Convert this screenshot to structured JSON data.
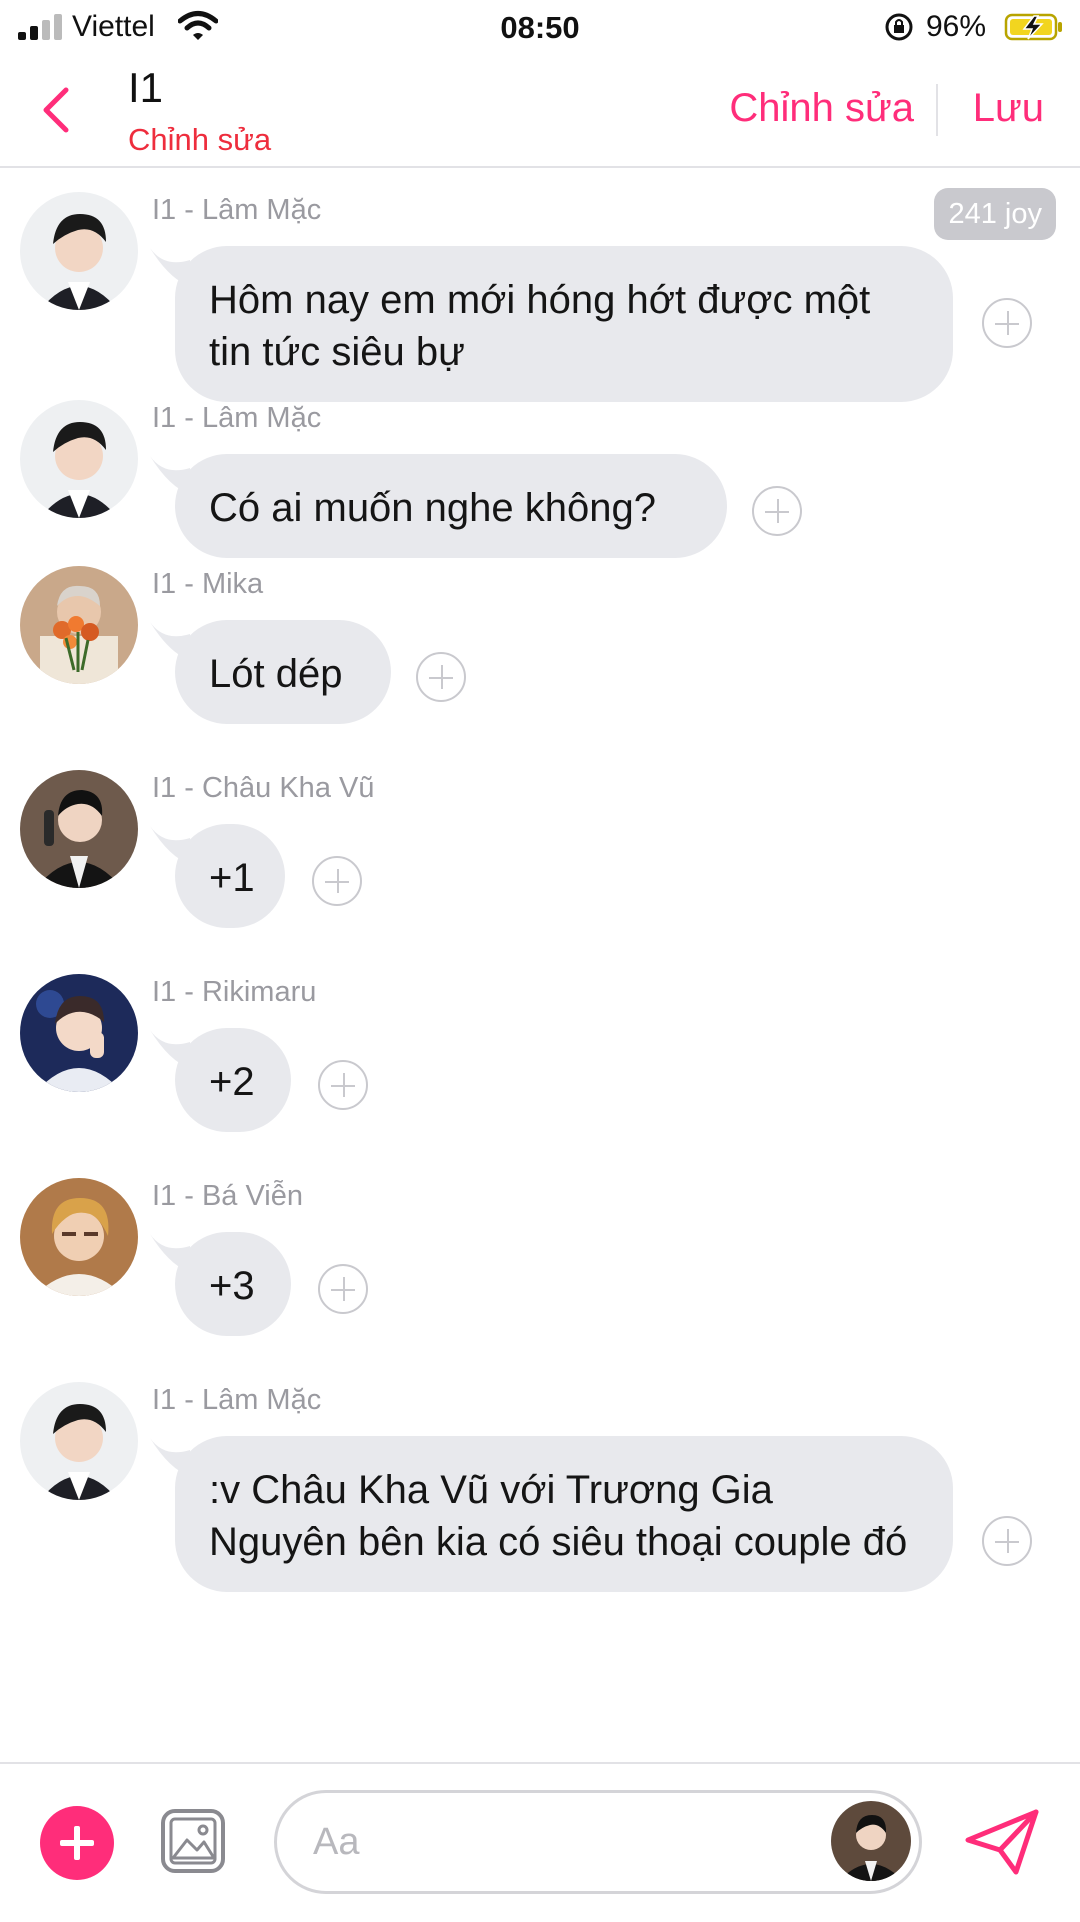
{
  "status_bar": {
    "carrier": "Viettel",
    "time": "08:50",
    "battery": "96%"
  },
  "header": {
    "title": "I1",
    "subtitle": "Chỉnh sửa",
    "edit_label": "Chỉnh sửa",
    "save_label": "Lưu"
  },
  "messages": [
    {
      "sender": "I1 - Lâm Mặc",
      "text": "Hôm nay em mới hóng hớt được một tin tức siêu bự",
      "badge": "241 joy"
    },
    {
      "sender": "I1 - Lâm Mặc",
      "text": "Có ai muốn nghe không?"
    },
    {
      "sender": "I1 - Mika",
      "text": "Lót dép"
    },
    {
      "sender": "I1 - Châu Kha Vũ",
      "text": "+1"
    },
    {
      "sender": "I1 - Rikimaru",
      "text": "+2"
    },
    {
      "sender": "I1 -  Bá Viễn",
      "text": "+3"
    },
    {
      "sender": "I1 - Lâm Mặc",
      "text": ":v Châu Kha Vũ với Trương Gia Nguyên bên kia có siêu thoại couple đó"
    }
  ],
  "composer": {
    "placeholder": "Aa"
  },
  "colors": {
    "accent": "#ff2d7a",
    "subtitle_red": "#ee2d3d",
    "bubble": "#e8e9ed",
    "sender_gray": "#9a9aa0"
  },
  "icons": [
    "signal-icon",
    "wifi-icon",
    "orientation-lock-icon",
    "battery-charging-icon",
    "back-chevron-icon",
    "add-reaction-icon",
    "add-icon",
    "image-icon",
    "send-icon"
  ]
}
